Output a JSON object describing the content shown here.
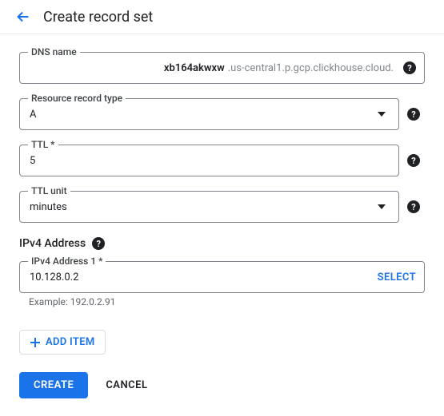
{
  "header": {
    "title": "Create record set"
  },
  "fields": {
    "dns": {
      "label": "DNS name",
      "value": "xb164akwxw",
      "suffix": ".us-central1.p.gcp.clickhouse.cloud."
    },
    "recordType": {
      "label": "Resource record type",
      "value": "A"
    },
    "ttl": {
      "label": "TTL *",
      "value": "5"
    },
    "ttlUnit": {
      "label": "TTL unit",
      "value": "minutes"
    }
  },
  "ipv4": {
    "sectionTitle": "IPv4 Address",
    "addresses": [
      {
        "label": "IPv4 Address 1 *",
        "value": "10.128.0.2",
        "selectLabel": "SELECT"
      }
    ],
    "hint": "Example: 192.0.2.91"
  },
  "buttons": {
    "addItem": "ADD ITEM",
    "create": "CREATE",
    "cancel": "CANCEL"
  }
}
